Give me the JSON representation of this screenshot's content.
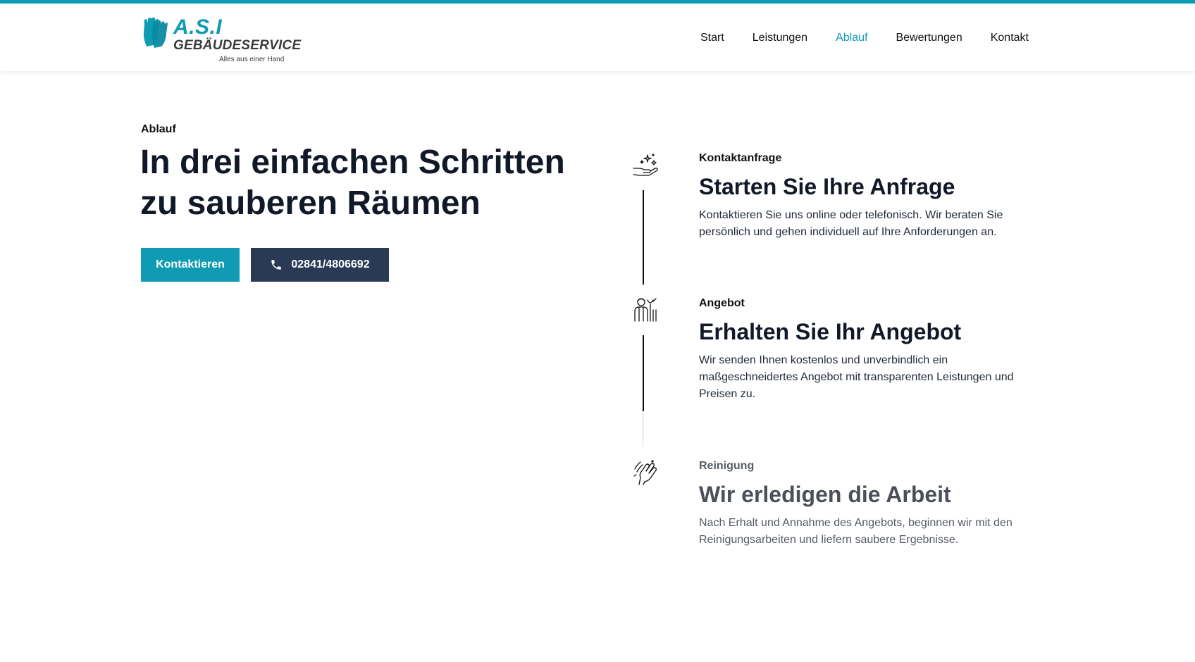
{
  "brand": {
    "name": "A.S.I",
    "service": "GEBÄUDESERVICE",
    "tagline": "Alles aus einer Hand"
  },
  "nav": [
    {
      "label": "Start"
    },
    {
      "label": "Leistungen"
    },
    {
      "label": "Ablauf"
    },
    {
      "label": "Bewertungen"
    },
    {
      "label": "Kontakt"
    }
  ],
  "nav_active": "Ablauf",
  "hero": {
    "eyebrow": "Ablauf",
    "headline": "In drei einfachen Schritten zu sauberen Räumen",
    "contact_label": "Kontaktieren",
    "phone_label": "02841/4806692"
  },
  "steps": [
    {
      "label": "Kontaktanfrage",
      "title": "Starten Sie Ihre Anfrage",
      "text": "Kontaktieren Sie uns online oder telefonisch. Wir beraten Sie persönlich und gehen individuell auf Ihre Anforderungen an.",
      "icon": "sparkle-hand-icon"
    },
    {
      "label": "Angebot",
      "title": "Erhalten Sie Ihr Angebot",
      "text": "Wir senden Ihnen kostenlos und unverbindlich ein maßgeschneidertes Angebot mit transparenten Leistungen und Preisen zu.",
      "icon": "cleaner-worker-icon"
    },
    {
      "label": "Reinigung",
      "title": "Wir erledigen die Arbeit",
      "text": "Nach Erhalt und Annahme des Angebots, beginnen wir mit den Reinigungsarbeiten und liefern saubere Ergebnisse.",
      "icon": "wiping-hand-icon"
    }
  ],
  "colors": {
    "accent": "#0e9bb3",
    "dark_button": "#2a3a55",
    "text": "#111827"
  }
}
